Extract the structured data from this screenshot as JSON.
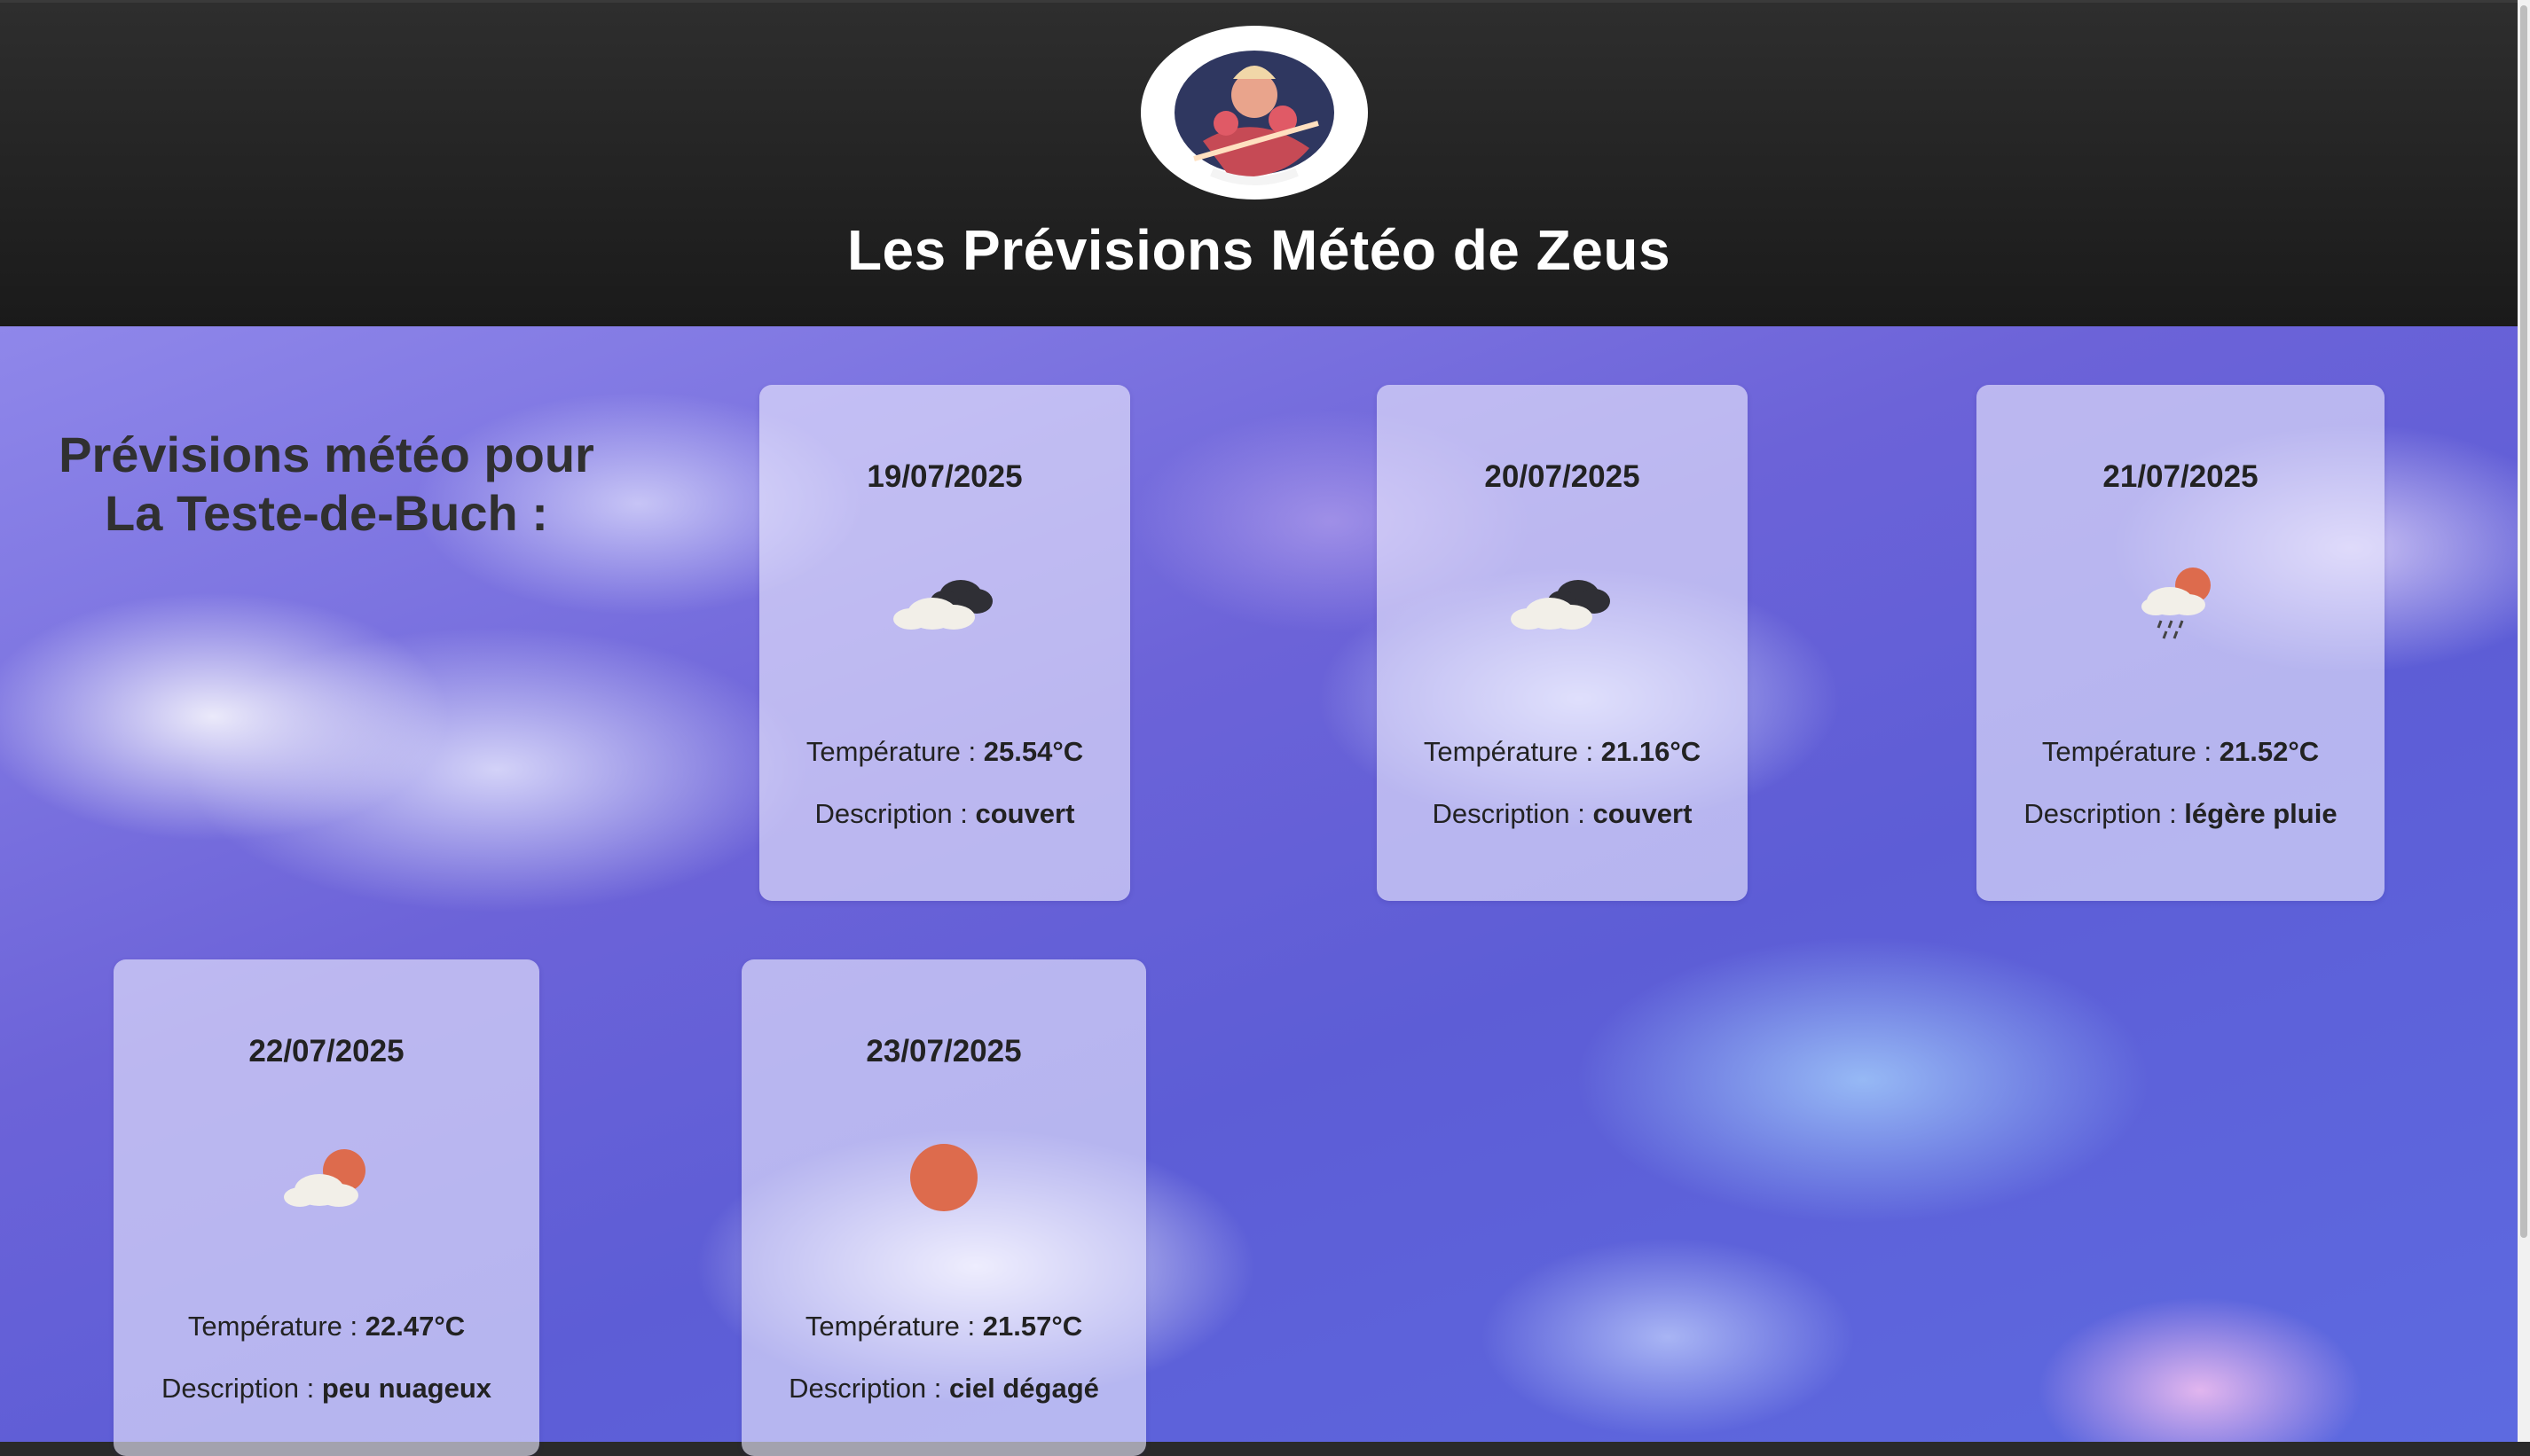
{
  "header": {
    "title": "Les Prévisions Météo de Zeus"
  },
  "forecast": {
    "heading": "Prévisions météo pour La Teste-de-Buch :",
    "temp_label": "Température : ",
    "desc_label": "Description : ",
    "days": [
      {
        "date": "19/07/2025",
        "icon": "overcast-clouds-icon",
        "temperature": "25.54°C",
        "description": "couvert"
      },
      {
        "date": "20/07/2025",
        "icon": "overcast-clouds-icon",
        "temperature": "21.16°C",
        "description": "couvert"
      },
      {
        "date": "21/07/2025",
        "icon": "light-rain-icon",
        "temperature": "21.52°C",
        "description": "légère pluie"
      },
      {
        "date": "22/07/2025",
        "icon": "few-clouds-icon",
        "temperature": "22.47°C",
        "description": "peu nuageux"
      },
      {
        "date": "23/07/2025",
        "icon": "clear-sky-icon",
        "temperature": "21.57°C",
        "description": "ciel dégagé"
      }
    ]
  },
  "colors": {
    "header_bg": "#1f1f1f",
    "sun": "#dd6b4d",
    "dark_cloud": "#2f2f35"
  }
}
